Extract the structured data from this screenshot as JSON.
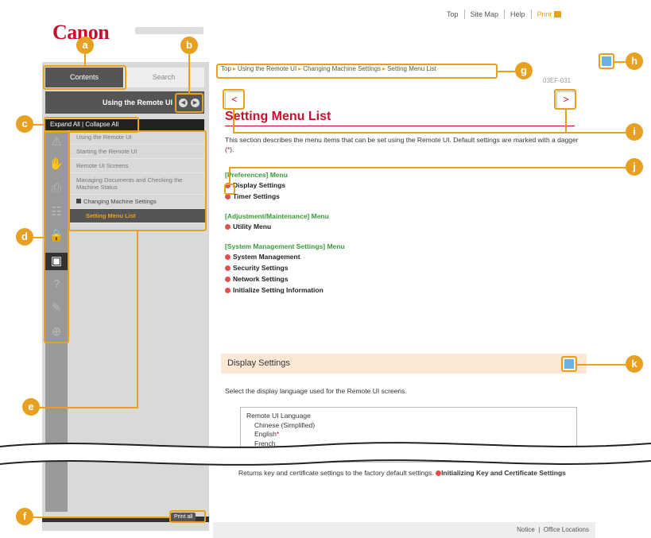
{
  "header": {
    "logo": "Canon",
    "top_links": [
      "Top",
      "Site Map",
      "Help"
    ],
    "print_label": "Print"
  },
  "sidebar": {
    "tabs": [
      "Contents",
      "Search"
    ],
    "section_title": "Using the Remote UI",
    "expand_all": "Expand All",
    "collapse_all": "Collapse All",
    "icons": [
      "warning-icon",
      "hand-icon",
      "printer-icon",
      "network-icon",
      "lock-icon",
      "remote-ui-icon",
      "help-icon",
      "wrench-icon",
      "plus-icon"
    ],
    "tree": [
      "Using the Remote UI",
      "Starting the Remote UI",
      "Remote UI Screens",
      "Managing Documents and Checking the Machine Status",
      "Changing Machine Settings",
      "Setting Menu List"
    ],
    "print_all": "Print all"
  },
  "breadcrumb": [
    "Top",
    "Using the Remote UI",
    "Changing Machine Settings",
    "Setting Menu List"
  ],
  "page": {
    "title": "Setting Menu List",
    "intro": "This section describes the menu items that can be set using the Remote UI. Default settings are marked with a dagger (",
    "dagger": "*",
    "intro_end": ").",
    "groups": [
      {
        "heading": "[Preferences] Menu",
        "items": [
          "Display Settings",
          "Timer Settings"
        ]
      },
      {
        "heading": "[Adjustment/Maintenance] Menu",
        "items": [
          "Utility Menu"
        ]
      },
      {
        "heading": "[System Management Settings] Menu",
        "items": [
          "System Management",
          "Security Settings",
          "Network Settings",
          "Initialize Setting Information"
        ]
      }
    ],
    "display_settings": {
      "title": "Display Settings",
      "description": "Select the display language used for the Remote UI screens.",
      "box_title": "Remote UI Language",
      "options": [
        "Chinese (Simplified)",
        "English",
        "French"
      ]
    },
    "returns_text": "Returns key and certificate settings to the factory default settings.",
    "returns_link": "Initializing Key and Certificate Settings"
  },
  "footer": {
    "notice": "Notice",
    "office": "Office Locations"
  },
  "markers": [
    "a",
    "b",
    "c",
    "d",
    "e",
    "f",
    "g",
    "h",
    "i",
    "j",
    "k"
  ],
  "colors": {
    "accent": "#e8a020",
    "brand": "#c8102e",
    "green": "#3a9a3a"
  }
}
